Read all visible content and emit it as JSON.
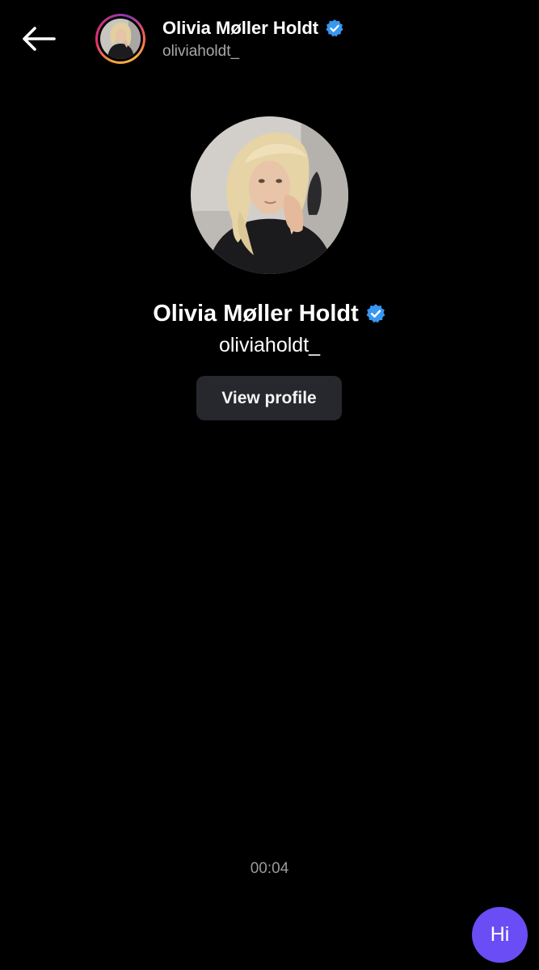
{
  "header": {
    "back_icon": "arrow-left-icon",
    "name": "Olivia Møller Holdt",
    "handle": "oliviaholdt_",
    "verified_icon": "verified-badge-icon"
  },
  "profile": {
    "name": "Olivia Møller Holdt",
    "handle": "oliviaholdt_",
    "view_profile_label": "View profile"
  },
  "thread": {
    "timestamp": "00:04",
    "messages": [
      {
        "sender": "me",
        "text": "Hi"
      }
    ]
  },
  "colors": {
    "background": "#000000",
    "verified_blue": "#3897f0",
    "bubble_purple": "#6a4df5",
    "button_gray": "#26282d",
    "muted_text": "#a8a8a8"
  }
}
